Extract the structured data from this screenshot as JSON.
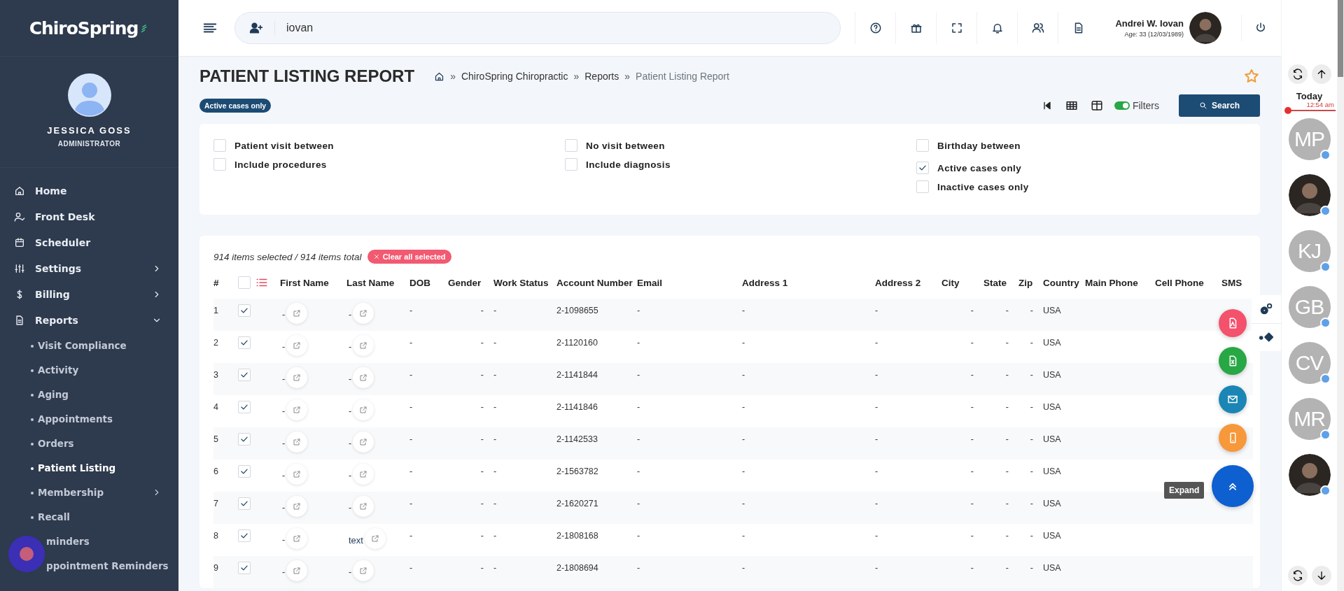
{
  "brand": {
    "name": "ChiroSpring"
  },
  "user": {
    "name": "JESSICA GOSS",
    "role": "ADMINISTRATOR"
  },
  "nav": [
    {
      "label": "Home",
      "kind": "link"
    },
    {
      "label": "Front Desk",
      "kind": "link"
    },
    {
      "label": "Scheduler",
      "kind": "link"
    },
    {
      "label": "Settings",
      "kind": "group",
      "expanded": false
    },
    {
      "label": "Billing",
      "kind": "group",
      "expanded": false
    },
    {
      "label": "Reports",
      "kind": "group",
      "expanded": true,
      "children": [
        {
          "label": "Visit Compliance",
          "selected": false,
          "kind": "link"
        },
        {
          "label": "Activity",
          "selected": false,
          "kind": "link"
        },
        {
          "label": "Aging",
          "selected": false,
          "kind": "link"
        },
        {
          "label": "Appointments",
          "selected": false,
          "kind": "link"
        },
        {
          "label": "Orders",
          "selected": false,
          "kind": "link"
        },
        {
          "label": "Patient Listing",
          "selected": true,
          "kind": "link"
        },
        {
          "label": "Membership",
          "selected": false,
          "kind": "group"
        },
        {
          "label": "Recall",
          "selected": false,
          "kind": "link"
        },
        {
          "label": "minders",
          "selected": false,
          "kind": "cut"
        },
        {
          "label": "ppointment Reminders",
          "selected": false,
          "kind": "cut"
        }
      ]
    }
  ],
  "header": {
    "search_value": "iovan",
    "patient_name": "Andrei W. Iovan",
    "patient_age": "Age: 33 (12/03/1989)"
  },
  "page": {
    "title": "PATIENT LISTING REPORT",
    "favorite": false,
    "breadcrumb": [
      {
        "separator": "»",
        "label": "ChiroSpring Chiropractic"
      },
      {
        "separator": "»",
        "label": "Reports"
      },
      {
        "separator": "»",
        "label": "Patient Listing Report"
      }
    ],
    "active_badge": "Active cases only",
    "filters_toggle": {
      "label": "Filters",
      "on": true
    },
    "search_button": "Search"
  },
  "filters": [
    [
      {
        "label": "Patient visit between",
        "checked": false
      },
      {
        "label": "Include procedures",
        "checked": false
      }
    ],
    [
      {
        "label": "No visit between",
        "checked": false
      },
      {
        "label": "Include diagnosis",
        "checked": false
      }
    ],
    [
      {
        "label": "Birthday between",
        "checked": false
      },
      {
        "label": "Active cases only",
        "checked": true
      },
      {
        "label": "Inactive cases only",
        "checked": false
      }
    ]
  ],
  "table": {
    "summary": "914 items selected / 914 items total",
    "clear_button": "Clear all selected",
    "header_checked": false,
    "columns": [
      "#",
      "First Name",
      "Last Name",
      "DOB",
      "Gender",
      "Work Status",
      "Account Number",
      "Email",
      "Address 1",
      "Address 2",
      "City",
      "State",
      "Zip",
      "Country",
      "Main Phone",
      "Cell Phone",
      "SMS"
    ],
    "rows": [
      {
        "num": "1",
        "selected": true,
        "first_name": "-",
        "last_name": "-",
        "dob": "-",
        "gender": "-",
        "work_status": "-",
        "account": "2-1098655",
        "email": "-",
        "address_1": "-",
        "address_2": "-",
        "city": "-",
        "state": "-",
        "zip": "-",
        "country": "USA"
      },
      {
        "num": "2",
        "selected": true,
        "first_name": "-",
        "last_name": "-",
        "dob": "-",
        "gender": "-",
        "work_status": "-",
        "account": "2-1120160",
        "email": "-",
        "address_1": "-",
        "address_2": "-",
        "city": "-",
        "state": "-",
        "zip": "-",
        "country": "USA"
      },
      {
        "num": "3",
        "selected": true,
        "first_name": "-",
        "last_name": "-",
        "dob": "-",
        "gender": "-",
        "work_status": "-",
        "account": "2-1141844",
        "email": "-",
        "address_1": "-",
        "address_2": "-",
        "city": "-",
        "state": "-",
        "zip": "-",
        "country": "USA"
      },
      {
        "num": "4",
        "selected": true,
        "first_name": "-",
        "last_name": "-",
        "dob": "-",
        "gender": "-",
        "work_status": "-",
        "account": "2-1141846",
        "email": "-",
        "address_1": "-",
        "address_2": "-",
        "city": "-",
        "state": "-",
        "zip": "-",
        "country": "USA"
      },
      {
        "num": "5",
        "selected": true,
        "first_name": "-",
        "last_name": "-",
        "dob": "-",
        "gender": "-",
        "work_status": "-",
        "account": "2-1142533",
        "email": "-",
        "address_1": "-",
        "address_2": "-",
        "city": "-",
        "state": "-",
        "zip": "-",
        "country": "USA"
      },
      {
        "num": "6",
        "selected": true,
        "first_name": "-",
        "last_name": "-",
        "dob": "-",
        "gender": "-",
        "work_status": "-",
        "account": "2-1563782",
        "email": "-",
        "address_1": "-",
        "address_2": "-",
        "city": "-",
        "state": "-",
        "zip": "-",
        "country": "USA"
      },
      {
        "num": "7",
        "selected": true,
        "first_name": "-",
        "last_name": "-",
        "dob": "-",
        "gender": "-",
        "work_status": "-",
        "account": "2-1620271",
        "email": "-",
        "address_1": "-",
        "address_2": "-",
        "city": "-",
        "state": "-",
        "zip": "-",
        "country": "USA"
      },
      {
        "num": "8",
        "selected": true,
        "first_name": "-",
        "last_name": "text",
        "dob": "-",
        "gender": "-",
        "work_status": "-",
        "account": "2-1808168",
        "email": "-",
        "address_1": "-",
        "address_2": "-",
        "city": "-",
        "state": "-",
        "zip": "-",
        "country": "USA"
      },
      {
        "num": "9",
        "selected": true,
        "first_name": "-",
        "last_name": "-",
        "dob": "-",
        "gender": "-",
        "work_status": "-",
        "account": "2-1808694",
        "email": "-",
        "address_1": "-",
        "address_2": "-",
        "city": "-",
        "state": "-",
        "zip": "-",
        "country": "USA"
      }
    ]
  },
  "expand_tooltip": "Expand",
  "schedule": {
    "day": "Today",
    "time": "12:54 am",
    "providers": [
      {
        "kind": "initials",
        "initials": "MP"
      },
      {
        "kind": "photo"
      },
      {
        "kind": "initials",
        "initials": "KJ"
      },
      {
        "kind": "initials",
        "initials": "GB"
      },
      {
        "kind": "initials",
        "initials": "CV"
      },
      {
        "kind": "initials",
        "initials": "MR"
      },
      {
        "kind": "photo"
      }
    ]
  }
}
